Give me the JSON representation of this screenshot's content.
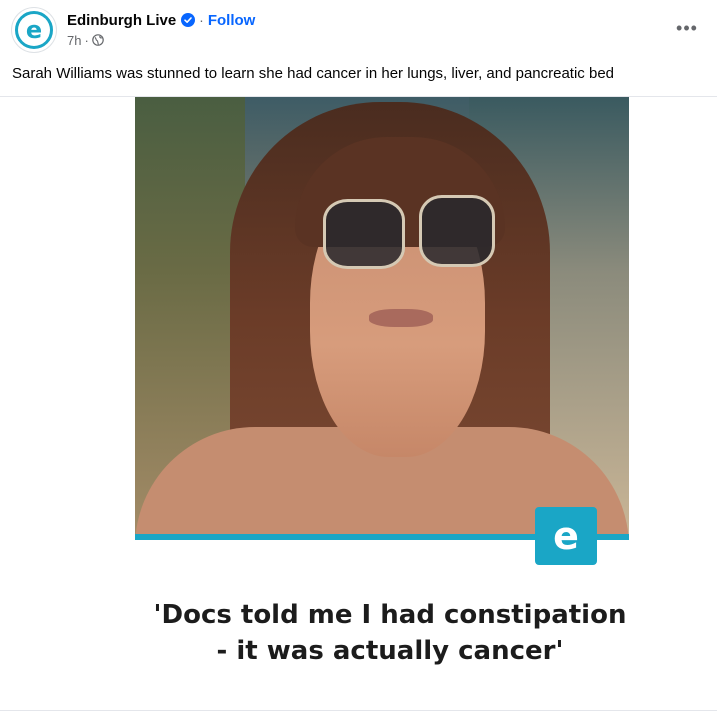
{
  "post": {
    "page_name": "Edinburgh Live",
    "avatar_letter": "e",
    "verified_icon": "verified-badge-icon",
    "follow_label": "Follow",
    "separator": "·",
    "time": "7h",
    "audience_icon": "globe-icon",
    "more_icon": "more-options-icon",
    "more_glyph": "•••",
    "caption": "Sarah Williams was stunned to learn she had cancer in her lungs, liver, and pancreatic bed"
  },
  "media": {
    "brand_letter": "e",
    "headline_line1": "'Docs told me I had constipation",
    "headline_line2": "- it was actually cancer'"
  },
  "colors": {
    "brand": "#1aa6c6",
    "link": "#0866ff",
    "meta": "#65676b"
  }
}
